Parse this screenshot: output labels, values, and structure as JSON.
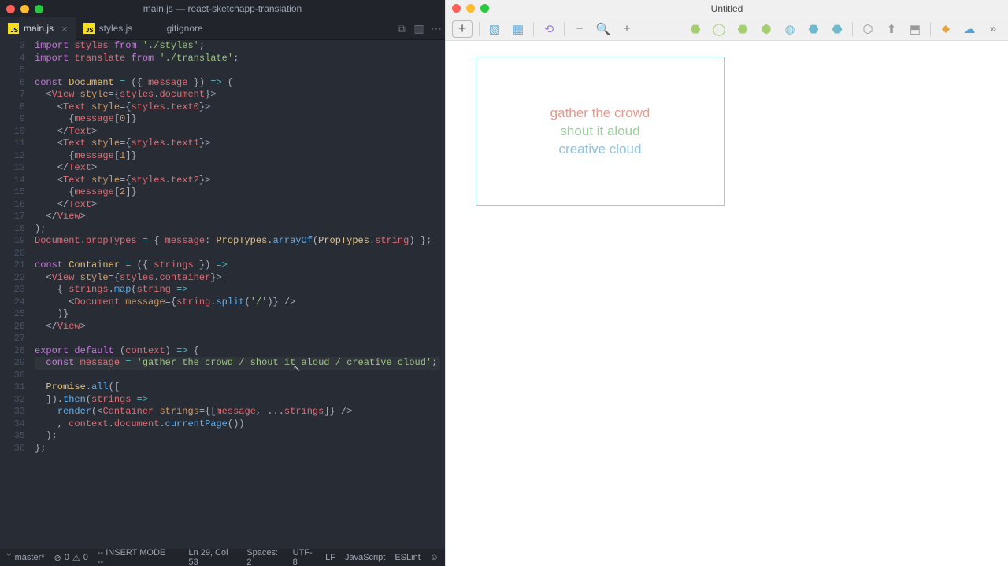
{
  "editor": {
    "window_title": "main.js — react-sketchapp-translation",
    "tabs": [
      {
        "label": "main.js",
        "icon": "js",
        "active": true
      },
      {
        "label": "styles.js",
        "icon": "js",
        "active": false
      },
      {
        "label": ".gitignore",
        "icon": "github",
        "active": false
      }
    ],
    "status": {
      "branch": "master*",
      "errors": "0",
      "warnings": "0",
      "mode": "-- INSERT MODE --",
      "ln_col": "Ln 29, Col 53",
      "spaces": "Spaces: 2",
      "encoding": "UTF-8",
      "eol": "LF",
      "language": "JavaScript",
      "linter": "ESLint"
    },
    "highlight_line": 29,
    "cursor_col": 53,
    "code_lines": [
      {
        "n": 3,
        "html": "<span class='kw'>import</span> <span class='var'>styles</span> <span class='kw'>from</span> <span class='str'>'./styles'</span>;"
      },
      {
        "n": 4,
        "html": "<span class='kw'>import</span> <span class='var'>translate</span> <span class='kw'>from</span> <span class='str'>'./translate'</span>;"
      },
      {
        "n": 5,
        "html": ""
      },
      {
        "n": 6,
        "html": "<span class='kw'>const</span> <span class='def'>Document</span> <span class='op'>=</span> ({ <span class='var'>message</span> }) <span class='op'>=&gt;</span> ("
      },
      {
        "n": 7,
        "html": "  &lt;<span class='tag'>View</span> <span class='attr'>style</span>={<span class='var'>styles</span>.<span class='prop'>document</span>}&gt;"
      },
      {
        "n": 8,
        "html": "    &lt;<span class='tag'>Text</span> <span class='attr'>style</span>={<span class='var'>styles</span>.<span class='prop'>text0</span>}&gt;"
      },
      {
        "n": 9,
        "html": "      {<span class='var'>message</span>[<span class='num'>0</span>]}"
      },
      {
        "n": 10,
        "html": "    &lt;/<span class='tag'>Text</span>&gt;"
      },
      {
        "n": 11,
        "html": "    &lt;<span class='tag'>Text</span> <span class='attr'>style</span>={<span class='var'>styles</span>.<span class='prop'>text1</span>}&gt;"
      },
      {
        "n": 12,
        "html": "      {<span class='var'>message</span>[<span class='num'>1</span>]}"
      },
      {
        "n": 13,
        "html": "    &lt;/<span class='tag'>Text</span>&gt;"
      },
      {
        "n": 14,
        "html": "    &lt;<span class='tag'>Text</span> <span class='attr'>style</span>={<span class='var'>styles</span>.<span class='prop'>text2</span>}&gt;"
      },
      {
        "n": 15,
        "html": "      {<span class='var'>message</span>[<span class='num'>2</span>]}"
      },
      {
        "n": 16,
        "html": "    &lt;/<span class='tag'>Text</span>&gt;"
      },
      {
        "n": 17,
        "html": "  &lt;/<span class='tag'>View</span>&gt;"
      },
      {
        "n": 18,
        "html": ");"
      },
      {
        "n": 19,
        "html": "<span class='var'>Document</span>.<span class='prop'>propTypes</span> <span class='op'>=</span> { <span class='var'>message</span>: <span class='def'>PropTypes</span>.<span class='fn'>arrayOf</span>(<span class='def'>PropTypes</span>.<span class='prop'>string</span>) };"
      },
      {
        "n": 20,
        "html": ""
      },
      {
        "n": 21,
        "html": "<span class='kw'>const</span> <span class='def'>Container</span> <span class='op'>=</span> ({ <span class='var'>strings</span> }) <span class='op'>=&gt;</span>"
      },
      {
        "n": 22,
        "html": "  &lt;<span class='tag'>View</span> <span class='attr'>style</span>={<span class='var'>styles</span>.<span class='prop'>container</span>}&gt;"
      },
      {
        "n": 23,
        "html": "    { <span class='var'>strings</span>.<span class='fn'>map</span>(<span class='var'>string</span> <span class='op'>=&gt;</span>"
      },
      {
        "n": 24,
        "html": "      &lt;<span class='tag'>Document</span> <span class='attr'>message</span>={<span class='var'>string</span>.<span class='fn'>split</span>(<span class='str'>'/'</span>)} /&gt;"
      },
      {
        "n": 25,
        "html": "    )}"
      },
      {
        "n": 26,
        "html": "  &lt;/<span class='tag'>View</span>&gt;"
      },
      {
        "n": 27,
        "html": ""
      },
      {
        "n": 28,
        "html": "<span class='kw'>export</span> <span class='kw'>default</span> (<span class='var'>context</span>) <span class='op'>=&gt;</span> {"
      },
      {
        "n": 29,
        "html": "  <span class='kw'>const</span> <span class='var'>message</span> <span class='op'>=</span> <span class='str'>'gather the crowd / shout it aloud / creative cloud'</span>;"
      },
      {
        "n": 30,
        "html": ""
      },
      {
        "n": 31,
        "html": "  <span class='def'>Promise</span>.<span class='fn'>all</span>(["
      },
      {
        "n": 32,
        "html": "  ]).<span class='fn'>then</span>(<span class='var'>strings</span> <span class='op'>=&gt;</span>"
      },
      {
        "n": 33,
        "html": "    <span class='fn'>render</span>(&lt;<span class='tag'>Container</span> <span class='attr'>strings</span>={[<span class='var'>message</span>, ...<span class='var'>strings</span>]} /&gt;"
      },
      {
        "n": 34,
        "html": "    , <span class='var'>context</span>.<span class='prop'>document</span>.<span class='fn'>currentPage</span>())"
      },
      {
        "n": 35,
        "html": "  );"
      },
      {
        "n": 36,
        "html": "};"
      }
    ]
  },
  "sketch": {
    "window_title": "Untitled",
    "canvas_text": {
      "line0": "gather the crowd",
      "line1": "shout it aloud",
      "line2": "creative cloud"
    },
    "zoom_minus": "−",
    "zoom_plus": "+"
  }
}
